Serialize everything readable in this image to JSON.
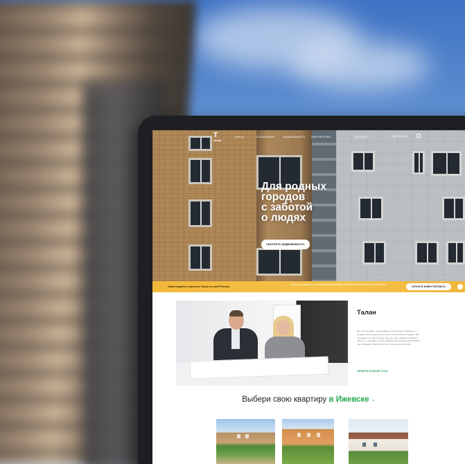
{
  "nav": {
    "logo_mark": "T",
    "logo_text": "талан",
    "items": [
      "ОФИСЫ",
      "О КОМПАНИИ",
      "НЕДВИЖИМОСТЬ",
      "ПАРТНЁРСТВО",
      "КОНТАКТЫ"
    ],
    "phone": "(000) 000-000"
  },
  "hero": {
    "title_lines": [
      "Для родных",
      "городов",
      "с заботой",
      "о людях"
    ],
    "button": "СМОТРЕТЬ НЕДВИЖИМОСТЬ"
  },
  "band": {
    "text": "Инвестируйте в проекты Талан по всей России",
    "description": "Удобная доходность, понятный объём вложений, персональный инвестиционный подход",
    "button": "НАЧНИТЕ ИНВЕСТИРОВАТЬ"
  },
  "about": {
    "title": "Талан",
    "text": "Мы строим дома – продуманные, комфортные, красивые, и создаем нашу среду на весь уже в 14 российских городах. Мы понимаем, что нельзя жить там, где тебе окружает любовь и забота, и стремимся, чтобы каждому наши дома приспособили уже обрушаем. Мы строим так, и как мы хотели своим",
    "link": "УЗНАЙТЕ БОЛЬШЕ О НАС"
  },
  "apartments": {
    "heading_prefix": "Выбери свою квартиру",
    "city": "в Ижевске"
  },
  "colors": {
    "accent_green": "#2aa850",
    "band_yellow": "#f5c24a",
    "frame_dark": "#1e1f22"
  }
}
